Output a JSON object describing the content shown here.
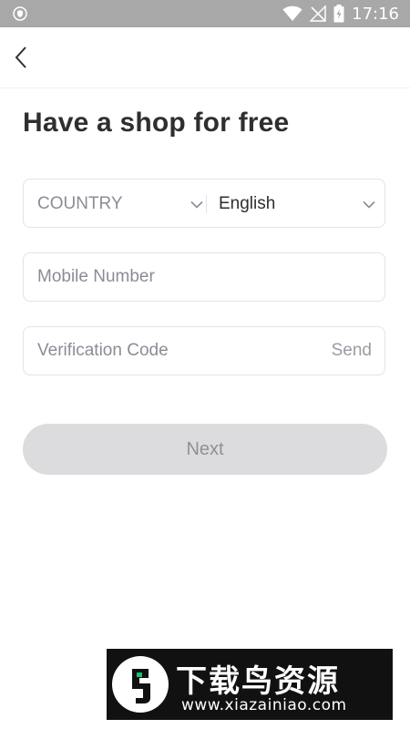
{
  "status_bar": {
    "time": "17:16",
    "icons": [
      "shield-icon",
      "wifi-icon",
      "no-signal-icon",
      "battery-charging-icon"
    ]
  },
  "header": {
    "back_icon": "chevron-left-icon"
  },
  "page": {
    "title": "Have a shop for free"
  },
  "form": {
    "country_label": "COUNTRY",
    "language_value": "English",
    "mobile_placeholder": "Mobile Number",
    "code_placeholder": "Verification Code",
    "send_label": "Send",
    "next_label": "Next"
  },
  "watermark": {
    "text": "下载鸟资源",
    "url": "www.xiazainiao.com"
  },
  "colors": {
    "status_bar": "#a8a8a8",
    "button_disabled": "#dcdcde",
    "placeholder": "#8a8d96",
    "border": "#e3e3e6"
  }
}
